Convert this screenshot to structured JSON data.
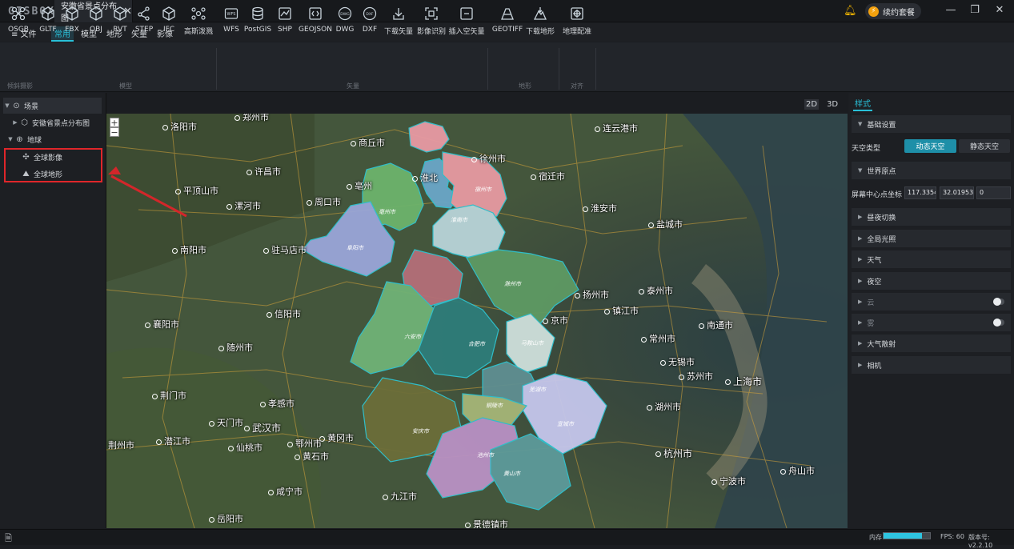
{
  "app": {
    "logo": "GISBOX",
    "doc_tab": "安徽省景点分布图",
    "renew": "续约套餐"
  },
  "menu": {
    "file": "≡ 文件",
    "tabs": [
      "常用",
      "模型",
      "地形",
      "矢量",
      "影像"
    ]
  },
  "ribbon": {
    "tools": [
      "OSGB",
      "GLTF",
      "FBX",
      "OBJ",
      "RVT",
      "STEP",
      "IFC",
      "高斯泼溅",
      "WFS",
      "PostGIS",
      "SHP",
      "GEOJSON",
      "DWG",
      "DXF",
      "下载矢量",
      "影像识别",
      "插入空矢量",
      "GEOTIFF",
      "下载地形",
      "地理配准"
    ],
    "groups": [
      "倾斜摄影",
      "模型",
      "矢量",
      "地形",
      "对齐"
    ]
  },
  "tree": {
    "scene": "场景",
    "scene_child": "安徽省景点分布图",
    "earth": "地球",
    "imagery": "全球影像",
    "terrain": "全球地形"
  },
  "view_modes": [
    "2D",
    "3D",
    "⊟"
  ],
  "map": {
    "cities": [
      "郑州市",
      "洛阳市",
      "商丘市",
      "徐州市",
      "连云港市",
      "淮北",
      "宿迁市",
      "许昌市",
      "亳州",
      "平顶山市",
      "周口市",
      "漯河市",
      "淮安市",
      "盐城市",
      "南阳市",
      "驻马店市",
      "扬州市",
      "泰州市",
      "信阳市",
      "镇江市",
      "襄阳市",
      "京市",
      "南通市",
      "随州市",
      "常州市",
      "无锡市",
      "苏州市",
      "上海市",
      "荆门市",
      "孝感市",
      "湖州市",
      "天门市",
      "武汉市",
      "黄冈市",
      "荆州市",
      "潜江市",
      "仙桃市",
      "鄂州市",
      "黄石市",
      "杭州市",
      "咸宁市",
      "九江市",
      "舟山市",
      "宁波市",
      "岳阳市",
      "景德镇市"
    ],
    "districts": [
      "宿州市",
      "阜阳市",
      "亳州市",
      "淮南市",
      "滁州市",
      "六安市",
      "合肥市",
      "马鞍山市",
      "芜湖市",
      "铜陵市",
      "宣城市",
      "安庆市",
      "池州市",
      "黄山市"
    ],
    "zoom_in": "+",
    "zoom_out": "−"
  },
  "style_panel": {
    "tab": "样式",
    "basic_settings": "基础设置",
    "sky_type_label": "天空类型",
    "sky_dynamic": "动态天空",
    "sky_static": "静态天空",
    "world_origin": "世界原点",
    "screen_center_label": "屏幕中心点坐标",
    "center_x": "117.3354",
    "center_y": "32.01953",
    "center_z": "0",
    "sections": [
      "昼夜切换",
      "全局光照",
      "天气",
      "夜空"
    ],
    "cloud": "云",
    "fog": "雾",
    "atmosphere": "大气散射",
    "camera": "相机"
  },
  "status": {
    "memory_label": "内存",
    "memory_fraction": 0.82,
    "fps": "FPS: 60",
    "version": "版本号: v2.2.10"
  },
  "colors": {
    "accent": "#29c0d8",
    "highlight_red": "#e0262a"
  }
}
